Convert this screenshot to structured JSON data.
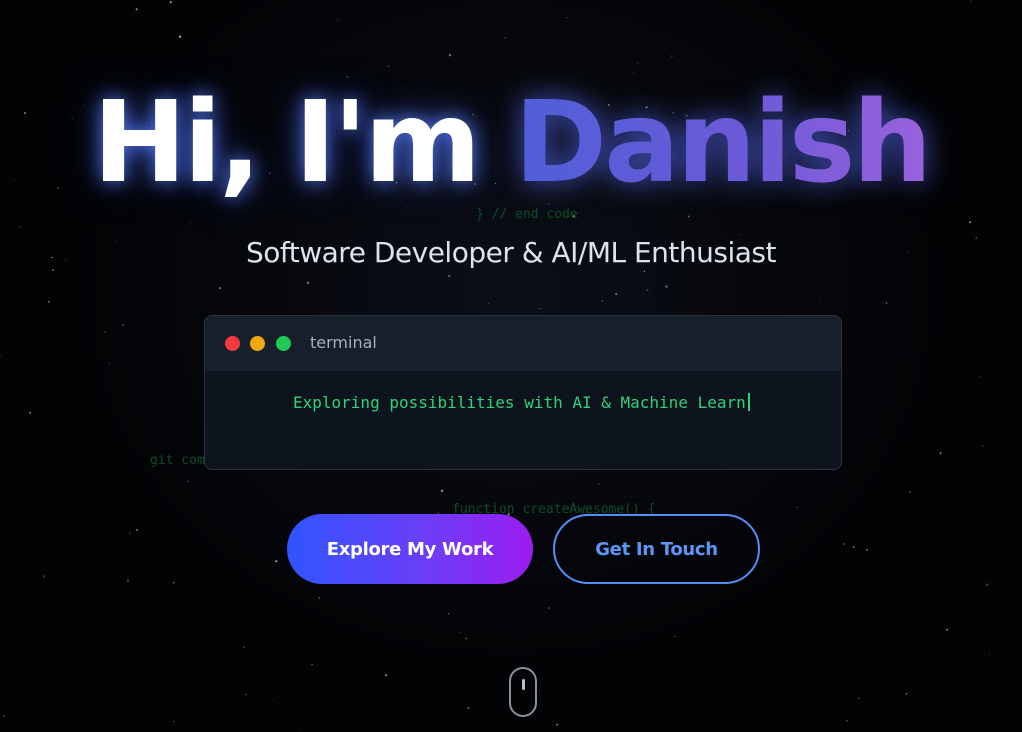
{
  "hero": {
    "headline_prefix": "Hi, I'm ",
    "headline_name": "Danish",
    "subtitle": "Software Developer & AI/ML Enthusiast"
  },
  "background_code": {
    "end_code": "} // end code",
    "git": "git com",
    "function": "function createAwesome() {"
  },
  "terminal": {
    "title": "terminal",
    "typed_text": "Exploring possibilities with AI & Machine Learn"
  },
  "buttons": {
    "explore_label": "Explore My Work",
    "contact_label": "Get In Touch"
  },
  "icons": {
    "scroll": "mouse-scroll-icon"
  },
  "colors": {
    "background": "#020305",
    "name_gradient_start": "#4f5fd8",
    "name_gradient_end": "#9a62dc",
    "terminal_text": "#2fd17a",
    "explore_gradient_start": "#2f55ff",
    "explore_gradient_end": "#9b1df0",
    "contact_accent": "#4f8ff7"
  }
}
